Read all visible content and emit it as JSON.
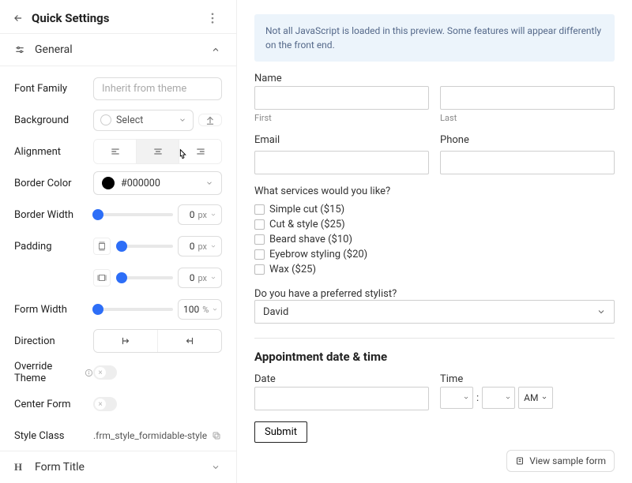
{
  "sidebar": {
    "title": "Quick Settings",
    "section_general": "General",
    "labels": {
      "font_family": "Font Family",
      "background": "Background",
      "alignment": "Alignment",
      "border_color": "Border Color",
      "border_width": "Border Width",
      "padding": "Padding",
      "form_width": "Form Width",
      "direction": "Direction",
      "override": "Override Theme",
      "center": "Center Form",
      "style_class": "Style Class"
    },
    "font_family_placeholder": "Inherit from theme",
    "bg_select": "Select",
    "border_color_value": "#000000",
    "border_width": {
      "value": "0",
      "unit": "px"
    },
    "padding_v": {
      "value": "0",
      "unit": "px"
    },
    "padding_h": {
      "value": "0",
      "unit": "px"
    },
    "form_width": {
      "value": "100",
      "unit": "%"
    },
    "style_class_value": ".frm_style_formidable-style",
    "section_form_title": "Form Title"
  },
  "preview": {
    "banner": "Not all JavaScript is loaded in this preview. Some features will appear differently on the front end.",
    "name_label": "Name",
    "first_hint": "First",
    "last_hint": "Last",
    "email_label": "Email",
    "phone_label": "Phone",
    "services_q": "What services would you like?",
    "services": [
      "Simple cut ($15)",
      "Cut & style ($25)",
      "Beard shave ($10)",
      "Eyebrow styling ($20)",
      "Wax ($25)"
    ],
    "stylist_q": "Do you have a preferred stylist?",
    "stylist_value": "David",
    "appt_title": "Appointment date & time",
    "date_label": "Date",
    "time_label": "Time",
    "time_ampm": "AM",
    "time_colon": ":",
    "submit": "Submit",
    "view_sample": "View sample form"
  }
}
